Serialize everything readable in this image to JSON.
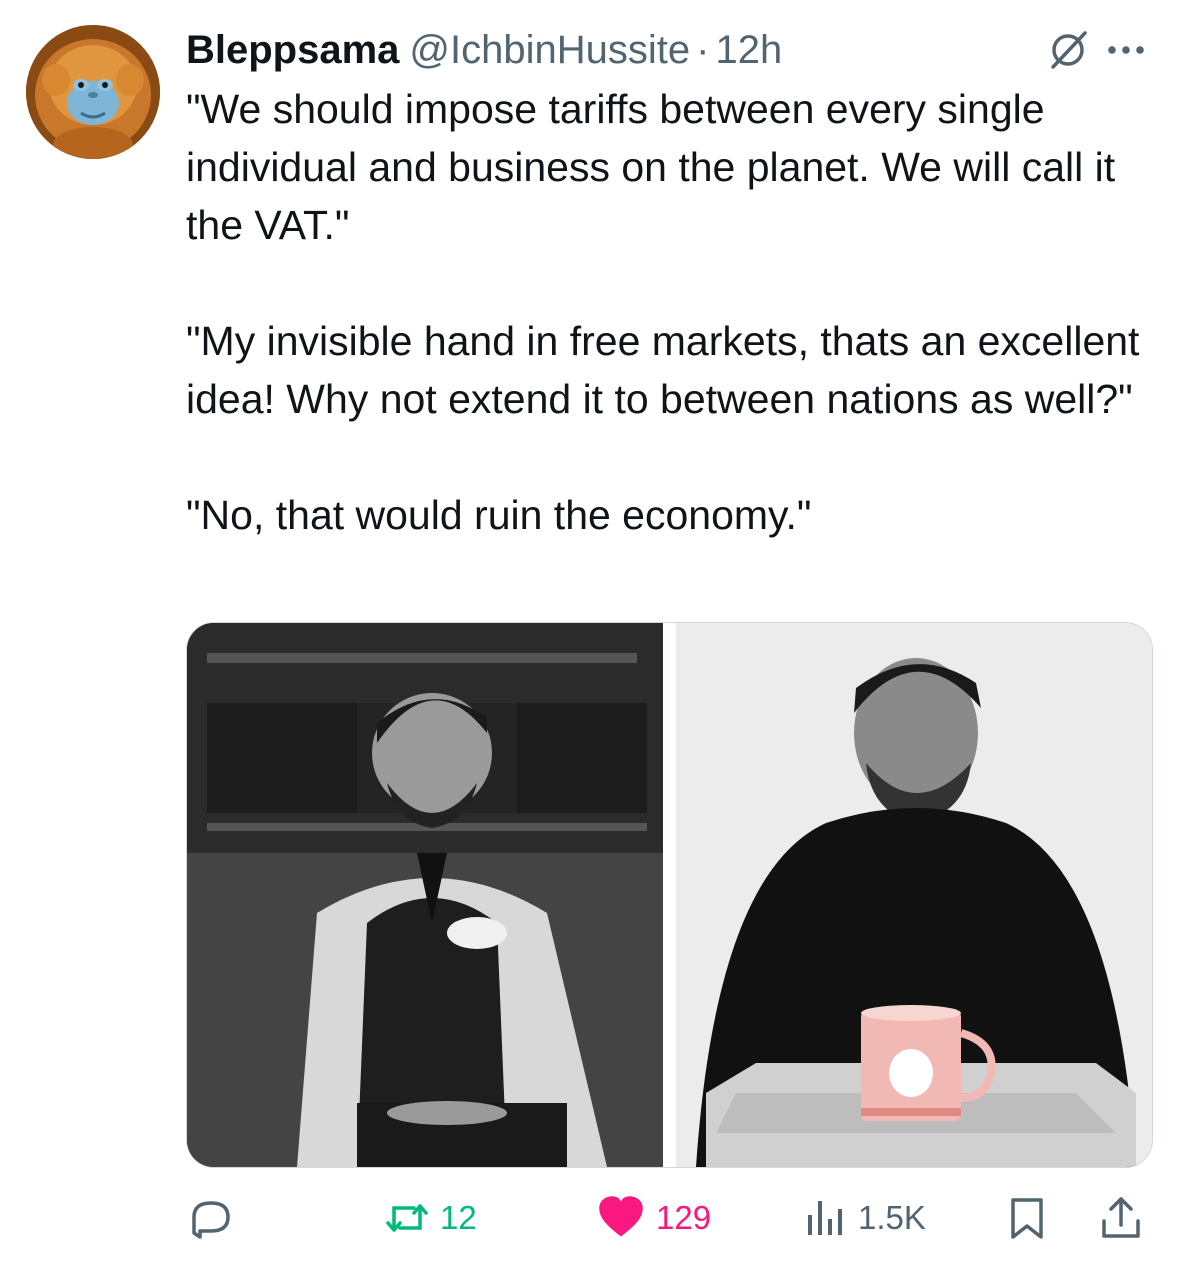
{
  "tweet": {
    "author": {
      "display_name": "Bleppsama",
      "handle": "@IchbinHussite",
      "separator": "·",
      "time_ago": "12h",
      "avatar_icon": "snub-nosed-monkey-avatar"
    },
    "header_icons": {
      "grok": "grok-icon",
      "more": "more-options-icon"
    },
    "text": {
      "paragraph_1": "\"We should impose tariffs between every single individual and business on the planet. We will call it the VAT.\"",
      "paragraph_2": "\"My invisible hand in free markets, thats an excellent idea! Why not extend it to between nations as well?\"",
      "paragraph_3": "\"No, that would ruin the economy.\""
    },
    "media": [
      {
        "name": "media-image-left",
        "kind": "photo"
      },
      {
        "name": "media-image-right",
        "kind": "photo"
      }
    ],
    "actions": {
      "reply_count": "",
      "retweet_count": "12",
      "like_count": "129",
      "views_count": "1.5K"
    },
    "colors": {
      "text_primary": "#0f1419",
      "text_secondary": "#536471",
      "retweet_active": "#00ba7c",
      "like_active": "#f91880",
      "border": "#cfd9de"
    }
  }
}
